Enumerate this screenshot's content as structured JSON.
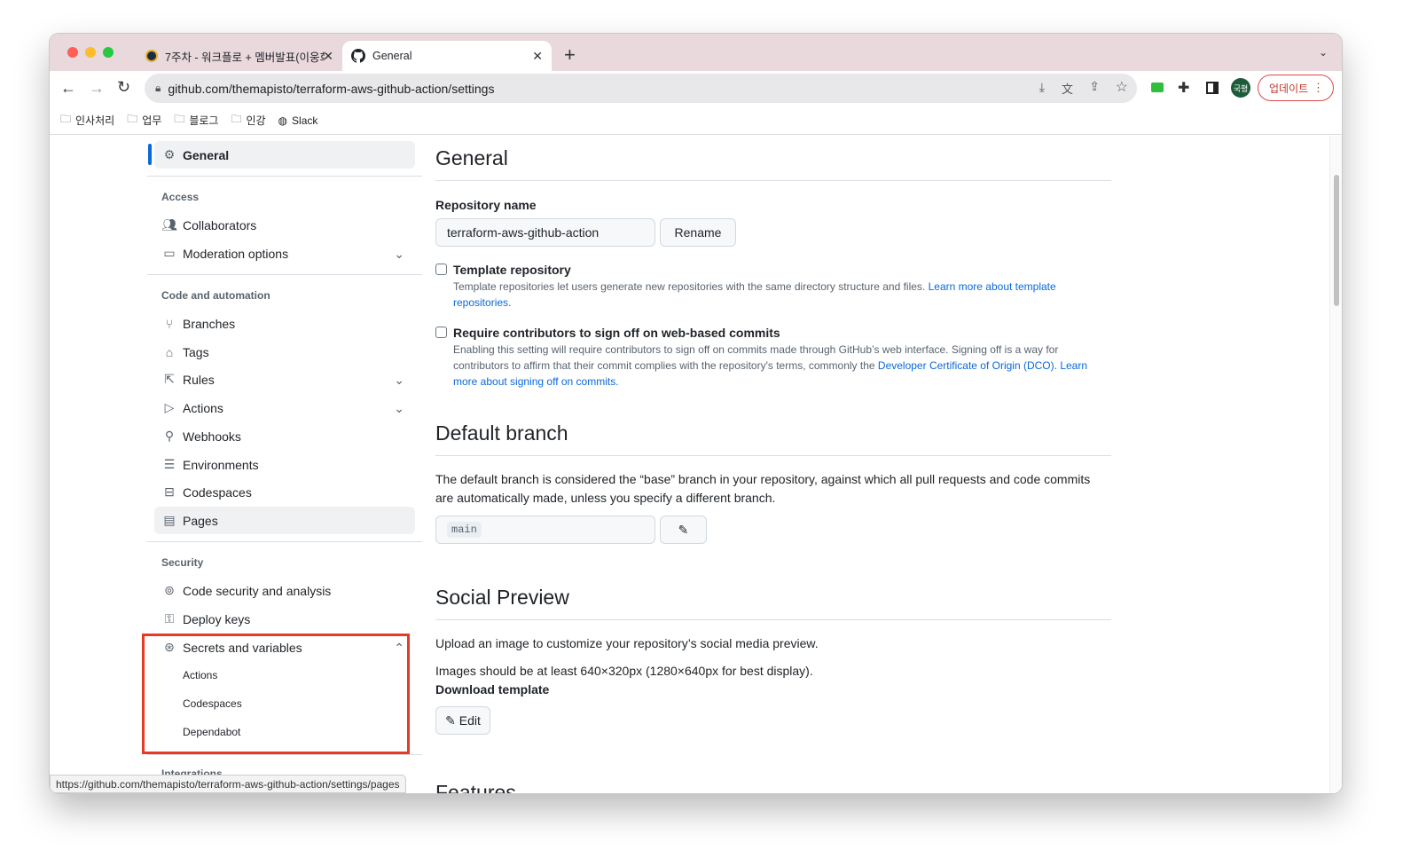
{
  "browser": {
    "tabs": [
      {
        "title": "7주차 - 워크플로 + 멤버발표(이웅희",
        "active": false
      },
      {
        "title": "General",
        "active": true
      }
    ],
    "url": "github.com/themapisto/terraform-aws-github-action/settings",
    "profile": "국평",
    "update_label": "업데이트",
    "bookmarks": [
      "인사처리",
      "업무",
      "블로그",
      "인강",
      "Slack"
    ],
    "status_url": "https://github.com/themapisto/terraform-aws-github-action/settings/pages"
  },
  "sidebar": {
    "general": "General",
    "access_heading": "Access",
    "access_items": [
      "Collaborators",
      "Moderation options"
    ],
    "code_heading": "Code and automation",
    "code_items": [
      "Branches",
      "Tags",
      "Rules",
      "Actions",
      "Webhooks",
      "Environments",
      "Codespaces",
      "Pages"
    ],
    "security_heading": "Security",
    "security_items": [
      "Code security and analysis",
      "Deploy keys",
      "Secrets and variables"
    ],
    "secrets_sub": [
      "Actions",
      "Codespaces",
      "Dependabot"
    ],
    "integrations_heading": "Integrations"
  },
  "main": {
    "general_title": "General",
    "repo_name_label": "Repository name",
    "repo_name_value": "terraform-aws-github-action",
    "rename_label": "Rename",
    "template_label": "Template repository",
    "template_desc": "Template repositories let users generate new repositories with the same directory structure and files. ",
    "template_link": "Learn more about template repositories.",
    "signoff_label": "Require contributors to sign off on web-based commits",
    "signoff_desc": "Enabling this setting will require contributors to sign off on commits made through GitHub’s web interface. Signing off is a way for contributors to affirm that their commit complies with the repository's terms, commonly the ",
    "signoff_link1": "Developer Certificate of Origin (DCO)",
    "signoff_link2": "Learn more about signing off on commits.",
    "default_branch_title": "Default branch",
    "default_branch_desc": "The default branch is considered the “base” branch in your repository, against which all pull requests and code commits are automatically made, unless you specify a different branch.",
    "default_branch_value": "main",
    "social_title": "Social Preview",
    "social_desc": "Upload an image to customize your repository’s social media preview.",
    "social_size": "Images should be at least 640×320px (1280×640px for best display).",
    "download_template": "Download template",
    "edit_label": "Edit",
    "features_title": "Features"
  },
  "colors": {
    "accent": "#0969da",
    "highlight_box": "#e53a25",
    "tab_strip": "#e9d8dc"
  }
}
